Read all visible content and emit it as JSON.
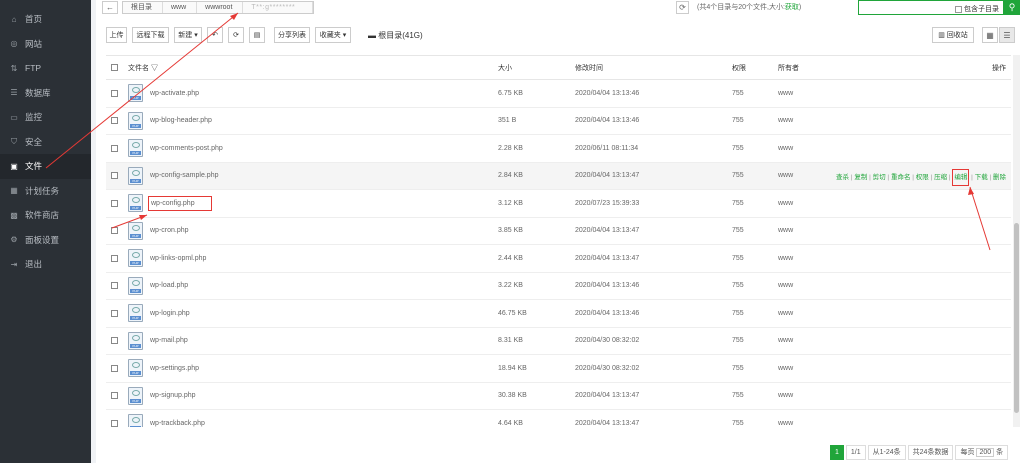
{
  "sidebar": {
    "items": [
      {
        "label": "首页",
        "icon": "home-icon",
        "glyph": "⌂"
      },
      {
        "label": "网站",
        "icon": "globe-icon",
        "glyph": "◎"
      },
      {
        "label": "FTP",
        "icon": "ftp-icon",
        "glyph": "⇅"
      },
      {
        "label": "数据库",
        "icon": "database-icon",
        "glyph": "☰"
      },
      {
        "label": "监控",
        "icon": "monitor-icon",
        "glyph": "▭"
      },
      {
        "label": "安全",
        "icon": "shield-icon",
        "glyph": "⛉"
      },
      {
        "label": "文件",
        "icon": "folder-icon",
        "glyph": "▣",
        "active": true
      },
      {
        "label": "计划任务",
        "icon": "calendar-icon",
        "glyph": "▦"
      },
      {
        "label": "软件商店",
        "icon": "grid-icon",
        "glyph": "▩"
      },
      {
        "label": "面板设置",
        "icon": "gear-icon",
        "glyph": "⚙"
      },
      {
        "label": "退出",
        "icon": "logout-icon",
        "glyph": "⇥"
      }
    ]
  },
  "pathbar": {
    "back": "←",
    "crumbs": [
      "根目录",
      "www",
      "wwwroot",
      "T**:g********"
    ],
    "refresh": "⟳",
    "info_prefix": "(共4个目录与20个文件,大小:",
    "info_link": "获取",
    "info_suffix": ")",
    "include_sub": "包含子目录",
    "search_icon": "⚲"
  },
  "toolbar": {
    "upload": "上传",
    "remote_download": "远程下载",
    "new": "新建 ▾",
    "back": "↶",
    "refresh": "⟳",
    "terminal": "▤",
    "share_list": "分享列表",
    "favorites": "收藏夹 ▾",
    "disk_label": "根目录(41G)",
    "recycle": "回收站",
    "view_grid": "▦",
    "view_list": "☰"
  },
  "table": {
    "headers": {
      "name": "文件名 ▽",
      "size": "大小",
      "mtime": "修改时间",
      "perm": "权限",
      "owner": "所有者",
      "ops": "操作"
    },
    "rows": [
      {
        "name": "wp-activate.php",
        "size": "6.75 KB",
        "mtime": "2020/04/04 13:13:46",
        "perm": "755",
        "owner": "www"
      },
      {
        "name": "wp-blog-header.php",
        "size": "351 B",
        "mtime": "2020/04/04 13:13:46",
        "perm": "755",
        "owner": "www"
      },
      {
        "name": "wp-comments-post.php",
        "size": "2.28 KB",
        "mtime": "2020/06/11 08:11:34",
        "perm": "755",
        "owner": "www"
      },
      {
        "name": "wp-config-sample.php",
        "size": "2.84 KB",
        "mtime": "2020/04/04 13:13:47",
        "perm": "755",
        "owner": "www"
      },
      {
        "name": "wp-config.php",
        "size": "3.12 KB",
        "mtime": "2020/07/23 15:39:33",
        "perm": "755",
        "owner": "www"
      },
      {
        "name": "wp-cron.php",
        "size": "3.85 KB",
        "mtime": "2020/04/04 13:13:47",
        "perm": "755",
        "owner": "www"
      },
      {
        "name": "wp-links-opml.php",
        "size": "2.44 KB",
        "mtime": "2020/04/04 13:13:47",
        "perm": "755",
        "owner": "www"
      },
      {
        "name": "wp-load.php",
        "size": "3.22 KB",
        "mtime": "2020/04/04 13:13:46",
        "perm": "755",
        "owner": "www"
      },
      {
        "name": "wp-login.php",
        "size": "46.75 KB",
        "mtime": "2020/04/04 13:13:46",
        "perm": "755",
        "owner": "www"
      },
      {
        "name": "wp-mail.php",
        "size": "8.31 KB",
        "mtime": "2020/04/30 08:32:02",
        "perm": "755",
        "owner": "www"
      },
      {
        "name": "wp-settings.php",
        "size": "18.94 KB",
        "mtime": "2020/04/30 08:32:02",
        "perm": "755",
        "owner": "www"
      },
      {
        "name": "wp-signup.php",
        "size": "30.38 KB",
        "mtime": "2020/04/04 13:13:47",
        "perm": "755",
        "owner": "www"
      },
      {
        "name": "wp-trackback.php",
        "size": "4.64 KB",
        "mtime": "2020/04/04 13:13:47",
        "perm": "755",
        "owner": "www"
      }
    ],
    "ops": [
      "查杀",
      "复制",
      "剪切",
      "重命名",
      "权限",
      "压缩",
      "编辑",
      "下载",
      "删除"
    ],
    "file_tag": "PHP"
  },
  "pager": {
    "current": "1",
    "of": "1/1",
    "range": "从1-24条",
    "total": "共24条数据",
    "per_page_prefix": "每页",
    "per_page": "200",
    "per_page_suffix": "条"
  },
  "colors": {
    "accent": "#20a53a",
    "annotation": "#e53935",
    "sidebar": "#2b3036"
  }
}
